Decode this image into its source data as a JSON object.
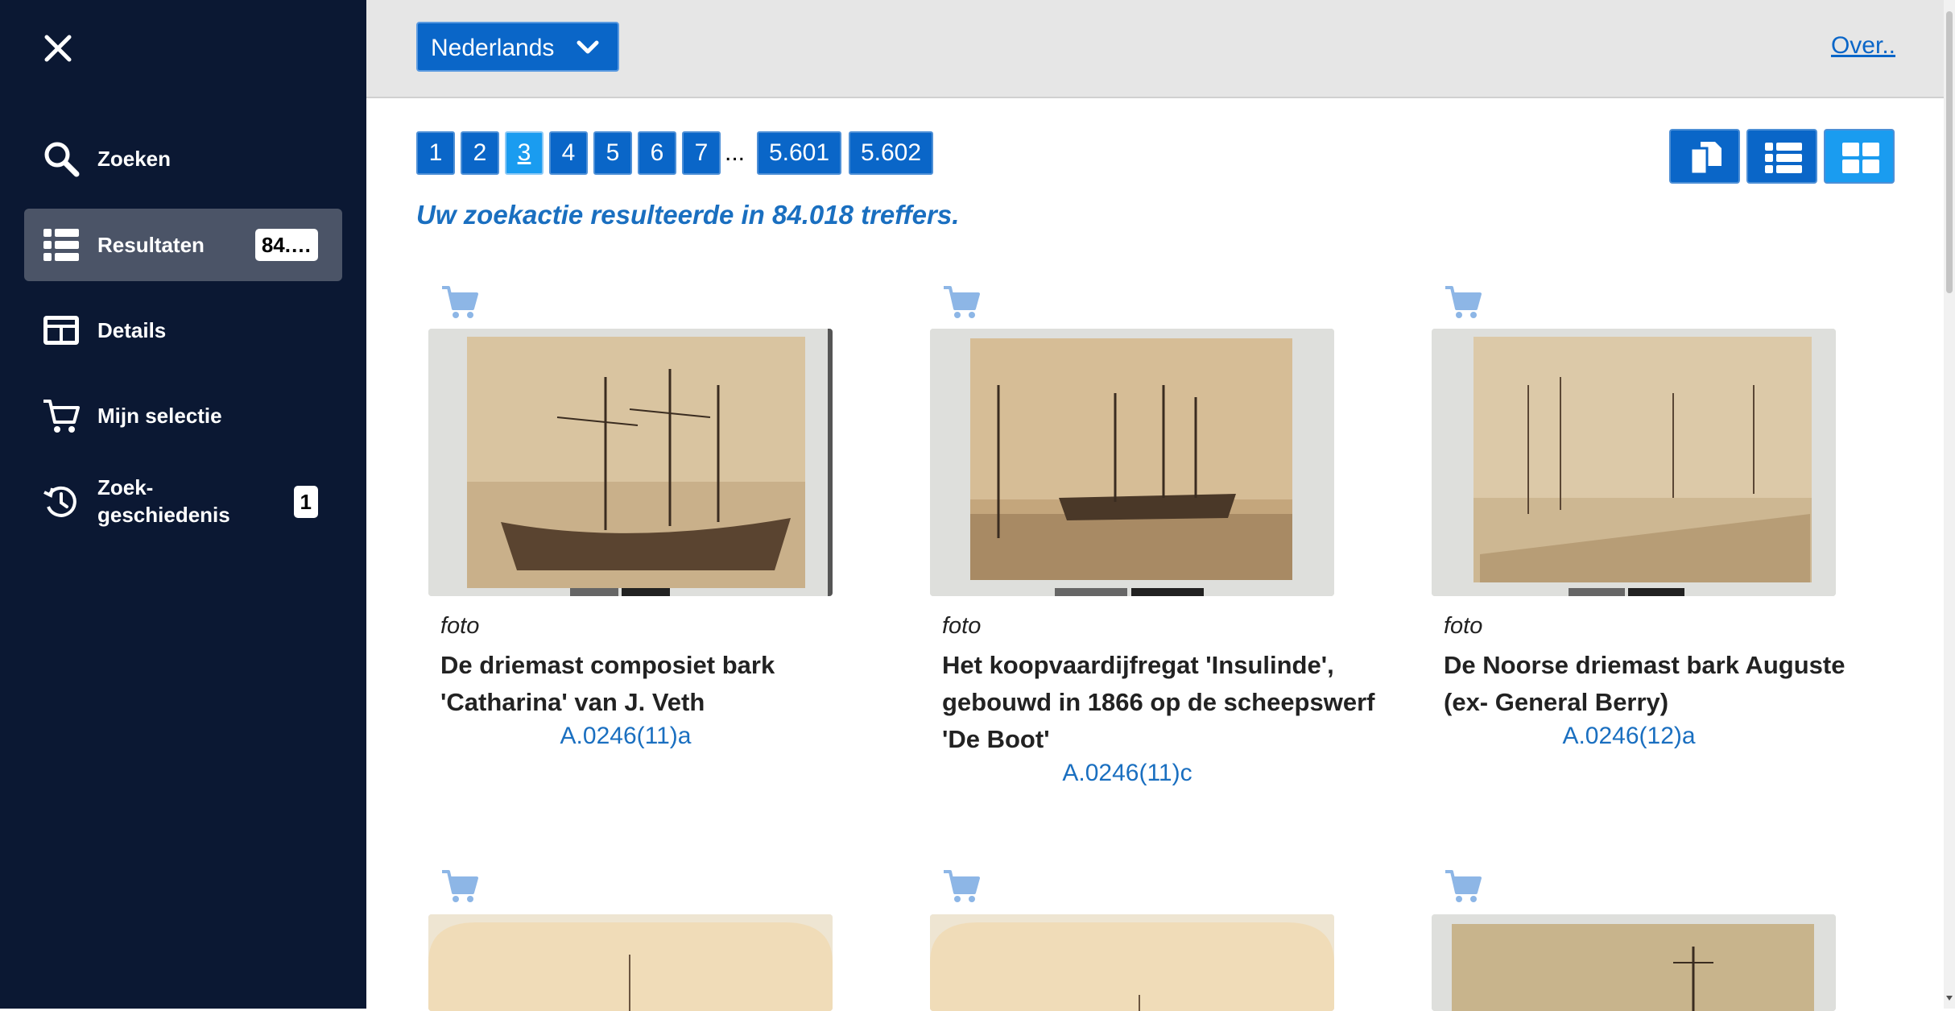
{
  "sidebar": {
    "items": [
      {
        "label": "Zoeken",
        "icon": "search-icon"
      },
      {
        "label": "Resultaten",
        "icon": "list-icon",
        "badge": "84.…",
        "active": true
      },
      {
        "label": "Details",
        "icon": "details-grid-icon"
      },
      {
        "label": "Mijn selectie",
        "icon": "cart-icon"
      },
      {
        "label_line1": "Zoek-",
        "label_line2": "geschiedenis",
        "icon": "history-icon",
        "badge": "1"
      }
    ]
  },
  "topbar": {
    "language": "Nederlands",
    "about_link": "Over.."
  },
  "pagination": {
    "pages": [
      "1",
      "2",
      "3",
      "4",
      "5",
      "6",
      "7"
    ],
    "current": "3",
    "ellipsis": "...",
    "last_pages": [
      "5.601",
      "5.602"
    ]
  },
  "results": {
    "summary": "Uw zoekactie resulteerde in 84.018 treffers."
  },
  "cards": [
    {
      "type": "foto",
      "title": "De driemast composiet bark 'Catharina' van J. Veth",
      "id": "A.0246(11)a"
    },
    {
      "type": "foto",
      "title": "Het koopvaardijfregat 'Insulinde', gebouwd in 1866 op de scheepswerf 'De Boot'",
      "id": "A.0246(11)c"
    },
    {
      "type": "foto",
      "title": "De Noorse driemast bark Auguste (ex- General Berry)",
      "id": "A.0246(12)a"
    }
  ],
  "colors": {
    "sidebar_bg": "#0b1833",
    "accent": "#0a66c8",
    "link": "#1a6fc0"
  }
}
